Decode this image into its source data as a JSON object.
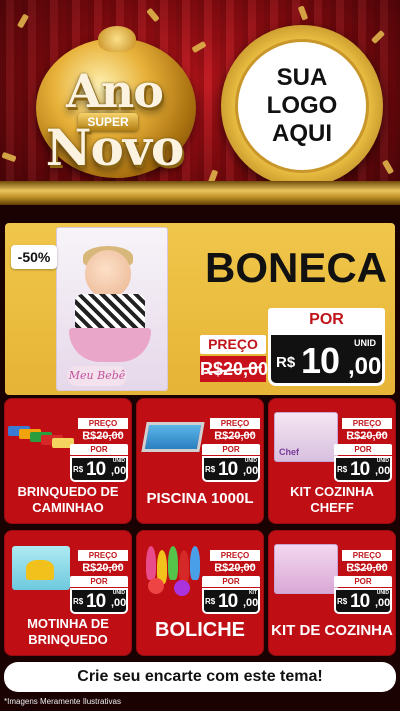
{
  "header": {
    "title_line1": "Ano",
    "title_badge": "SUPER",
    "title_line2": "Novo",
    "logo_placeholder": [
      "SUA",
      "LOGO",
      "AQUI"
    ]
  },
  "featured": {
    "discount": "-50%",
    "product_name": "BONECA",
    "package_brand": "Meu Bebê",
    "preco_label": "PREÇO",
    "old_price": "R$20,00",
    "por_label": "POR",
    "unit": "UNID",
    "currency": "R$",
    "price_int": "10",
    "price_dec": ",00"
  },
  "products": [
    {
      "name": "BRINQUEDO DE CAMINHAO",
      "preco_label": "PREÇO",
      "old_price": "R$20,00",
      "por_label": "POR",
      "currency": "R$",
      "price_int": "10",
      "price_dec": ",00",
      "unit": "UNID",
      "image": "toy-trucks"
    },
    {
      "name": "PISCINA 1000L",
      "preco_label": "PREÇO",
      "old_price": "R$20,00",
      "por_label": "POR",
      "currency": "R$",
      "price_int": "10",
      "price_dec": ",00",
      "unit": "UNID",
      "image": "pool"
    },
    {
      "name": "KIT COZINHA CHEFF",
      "preco_label": "PREÇO",
      "old_price": "R$20,00",
      "por_label": "POR",
      "currency": "R$",
      "price_int": "10",
      "price_dec": ",00",
      "unit": "UNID",
      "image": "kitchen-kit",
      "image_text": "Chef"
    },
    {
      "name": "MOTINHA DE BRINQUEDO",
      "preco_label": "PREÇO",
      "old_price": "R$20,00",
      "por_label": "POR",
      "currency": "R$",
      "price_int": "10",
      "price_dec": ",00",
      "unit": "UNID",
      "image": "toy-motorbike"
    },
    {
      "name": "BOLICHE",
      "preco_label": "PREÇO",
      "old_price": "R$20,00",
      "por_label": "POR",
      "currency": "R$",
      "price_int": "10",
      "price_dec": ",00",
      "unit": "KIT",
      "image": "bowling-set"
    },
    {
      "name": "KIT DE COZINHA",
      "preco_label": "PREÇO",
      "old_price": "R$20,00",
      "por_label": "POR",
      "currency": "R$",
      "price_int": "10",
      "price_dec": ",00",
      "unit": "UNID",
      "image": "kitchen-kit-2"
    }
  ],
  "cta": "Crie seu encarte com este tema!",
  "disclaimer": "*Imagens Meramente Ilustrativas",
  "colors": {
    "card_red": "#bf0f15",
    "featured_yellow": "#f0c64a",
    "price_black": "#111111",
    "gold": "#e6b93f"
  }
}
